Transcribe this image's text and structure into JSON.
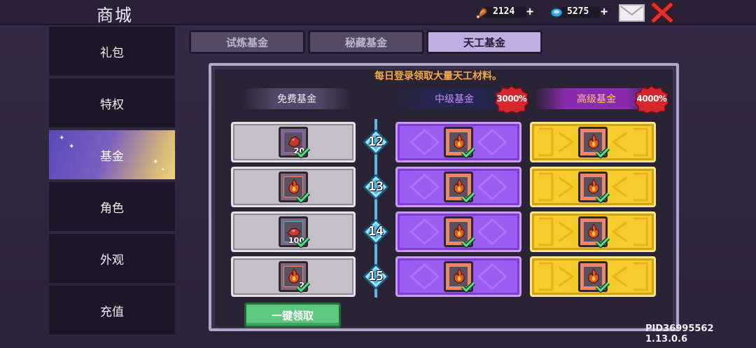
{
  "header": {
    "title": "商城",
    "resources": [
      {
        "icon": "meat-icon",
        "value": "2124"
      },
      {
        "icon": "gem-icon",
        "value": "5275"
      }
    ],
    "plus_glyph": "+"
  },
  "sidebar": {
    "items": [
      {
        "label": "礼包"
      },
      {
        "label": "特权"
      },
      {
        "label": "基金",
        "active": true
      },
      {
        "label": "角色"
      },
      {
        "label": "外观"
      },
      {
        "label": "充值"
      }
    ]
  },
  "tabs": [
    {
      "label": "试炼基金"
    },
    {
      "label": "秘藏基金"
    },
    {
      "label": "天工基金",
      "active": true
    }
  ],
  "panel": {
    "hint": "每日登录领取大量天工材料。",
    "columns": {
      "free": "免费基金",
      "mid": "中级基金",
      "high": "高级基金"
    },
    "badges": {
      "mid": "3000%",
      "high": "4000%"
    },
    "rows": [
      {
        "level": "12",
        "free": {
          "qty": "20",
          "kind": "ore"
        },
        "claimed": true
      },
      {
        "level": "13",
        "free": {
          "qty": "",
          "kind": "flame"
        },
        "claimed": true
      },
      {
        "level": "14",
        "free": {
          "qty": "100",
          "kind": "crystal"
        },
        "claimed": true
      },
      {
        "level": "15",
        "free": {
          "qty": "2",
          "kind": "flame"
        },
        "claimed": true
      }
    ],
    "claim_button": "一键领取"
  },
  "footer": {
    "version": "PID36995562 1.13.0.6"
  },
  "colors": {
    "mid_cell": "#9c5cf0",
    "high_cell": "#f6cb2c",
    "hint": "#f0a84a",
    "claim_button": "#5cc880"
  }
}
